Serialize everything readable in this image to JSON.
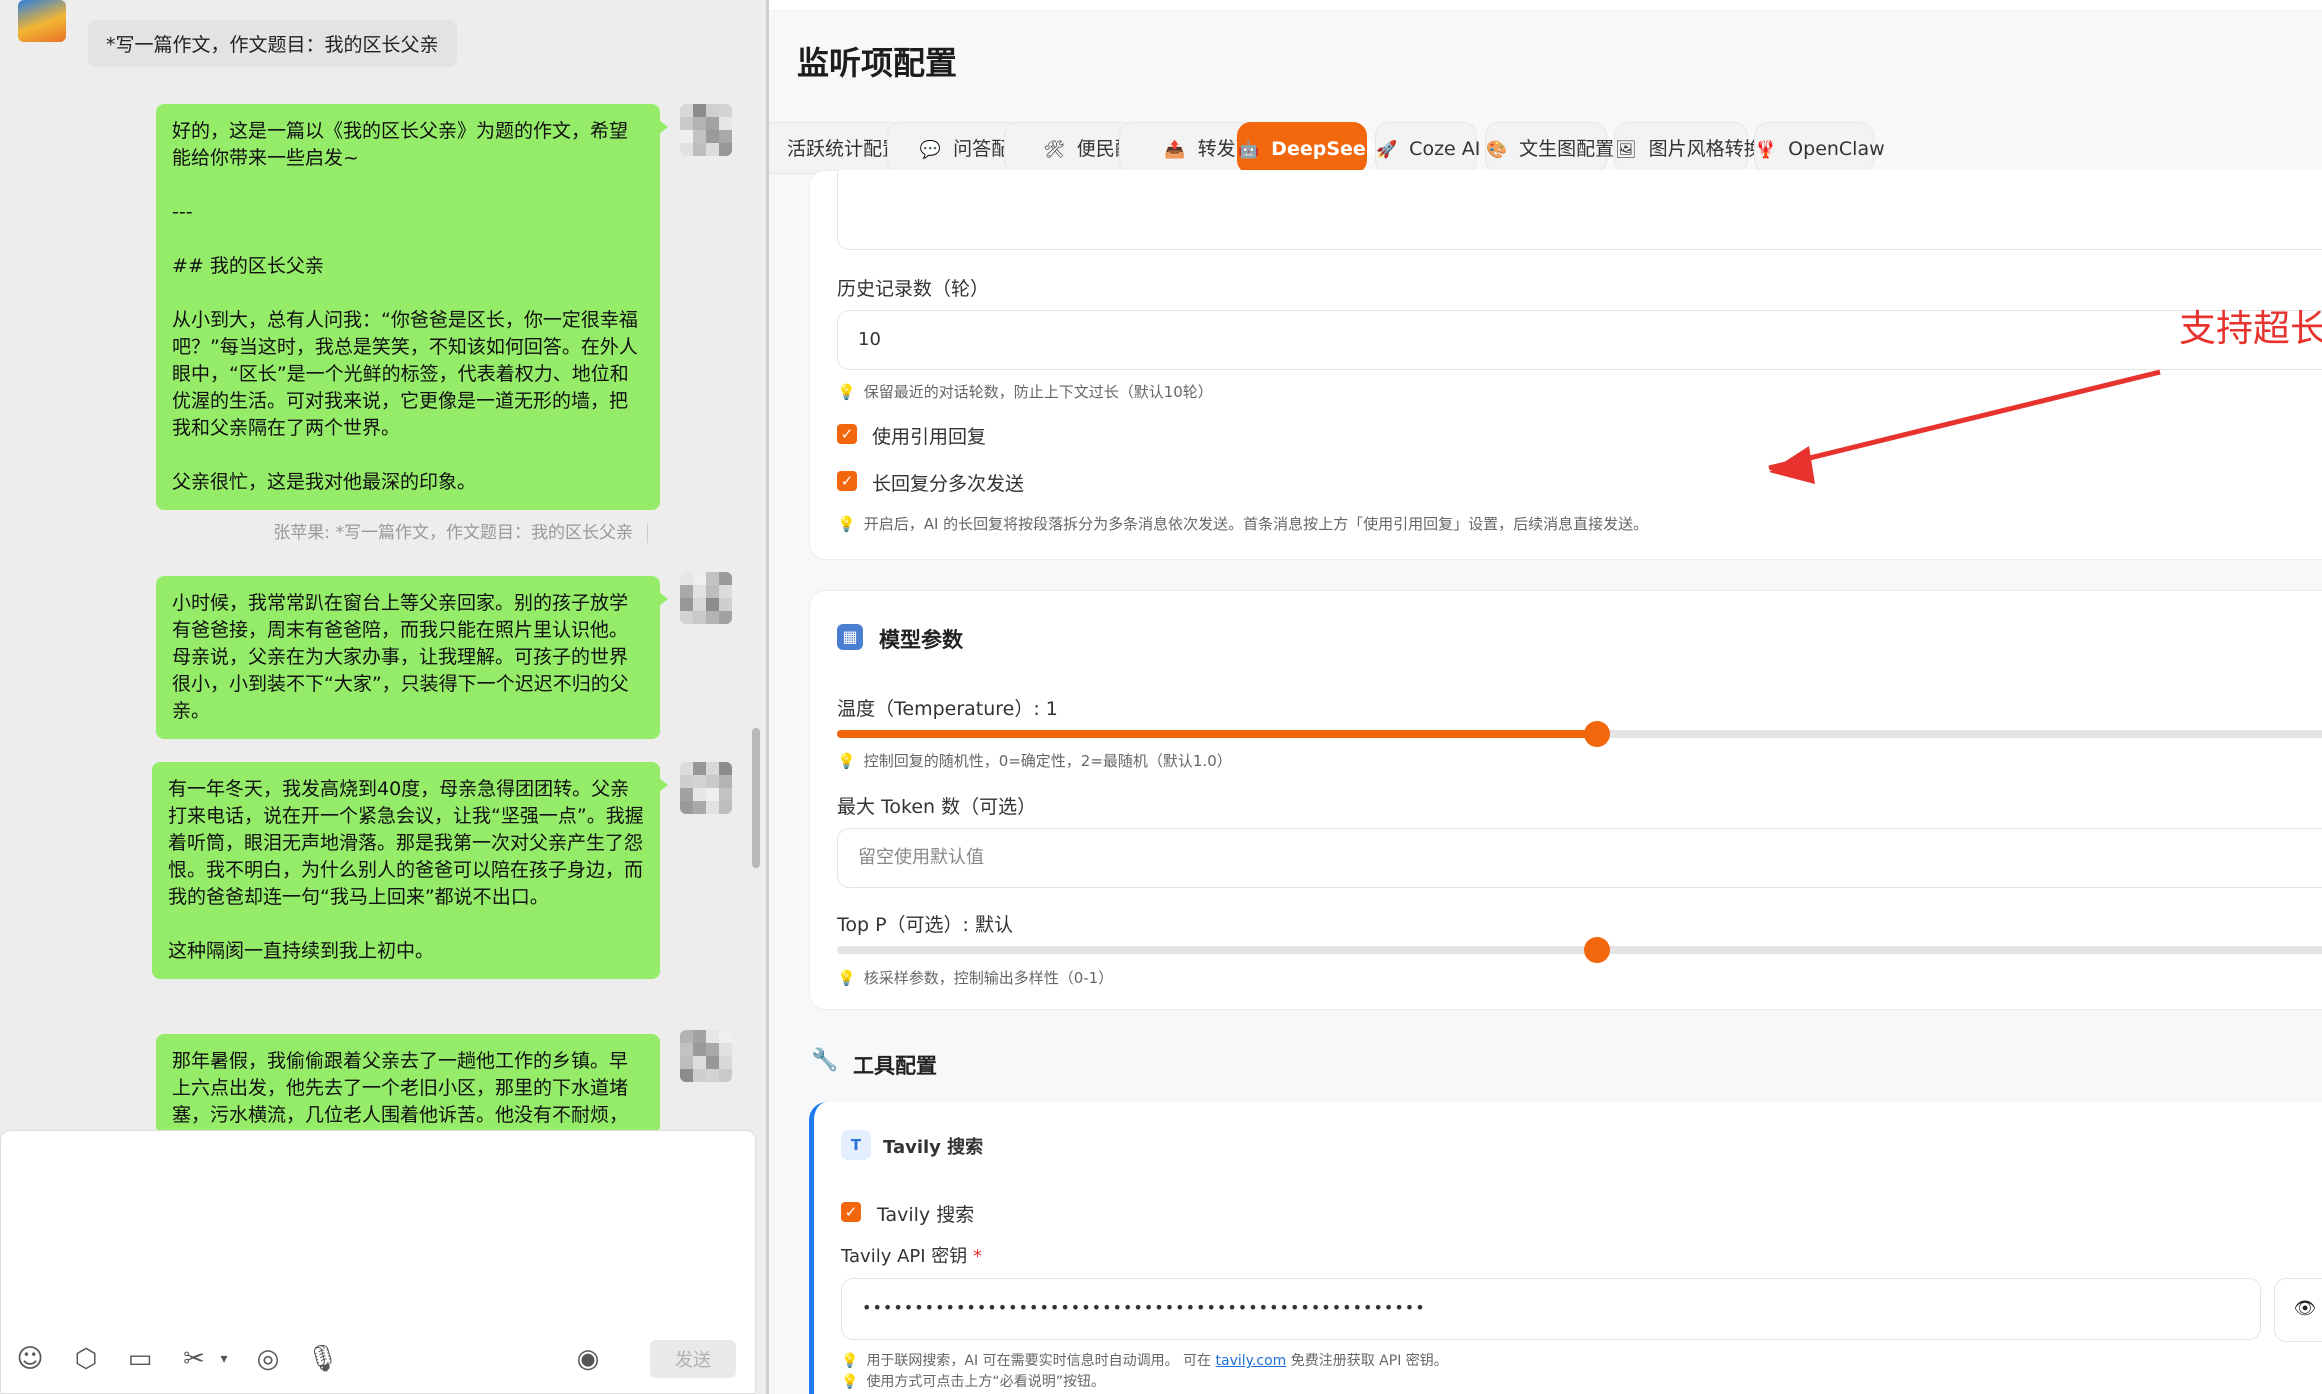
{
  "chat": {
    "incoming": "*写一篇作文，作文题目：我的区长父亲",
    "bubbles": [
      "好的，这是一篇以《我的区长父亲》为题的作文，希望能给你带来一些启发~\n\n---\n\n## 我的区长父亲\n\n从小到大，总有人问我：“你爸爸是区长，你一定很幸福吧？”每当这时，我总是笑笑，不知该如何回答。在外人眼中，“区长”是一个光鲜的标签，代表着权力、地位和优渥的生活。可对我来说，它更像是一道无形的墙，把我和父亲隔在了两个世界。\n\n父亲很忙，这是我对他最深的印象。",
      "小时候，我常常趴在窗台上等父亲回家。别的孩子放学有爸爸接，周末有爸爸陪，而我只能在照片里认识他。母亲说，父亲在为大家办事，让我理解。可孩子的世界很小，小到装不下“大家”，只装得下一个迟迟不归的父亲。",
      "有一年冬天，我发高烧到40度，母亲急得团团转。父亲打来电话，说在开一个紧急会议，让我“坚强一点”。我握着听筒，眼泪无声地滑落。那是我第一次对父亲产生了怨恨。我不明白，为什么别人的爸爸可以陪在孩子身边，而我的爸爸却连一句“我马上回来”都说不出口。\n\n这种隔阂一直持续到我上初中。",
      "那年暑假，我偷偷跟着父亲去了一趟他工作的乡镇。早上六点出发，他先去了一个老旧小区，那里的下水道堵塞，污水横流，几位老人围着他诉苦。他没有不耐烦，"
    ],
    "quote": "张苹果: *写一篇作文，作文题目：我的区长父亲",
    "send_label": "发送",
    "toolbar_icons": [
      "emoji-icon",
      "cube-icon",
      "folder-icon",
      "scissors-icon",
      "record-icon",
      "mic-icon",
      "voice-icon"
    ]
  },
  "panel": {
    "title": "监听项配置",
    "tabs": [
      {
        "icon": "",
        "label": "活跃统计配置"
      },
      {
        "icon": "💬",
        "label": "问答配置"
      },
      {
        "icon": "🛠",
        "label": "便民配置"
      },
      {
        "icon": "📤",
        "label": "转发配置"
      },
      {
        "icon": "🤖",
        "label": "DeepSeek AI"
      },
      {
        "icon": "🚀",
        "label": "Coze AI"
      },
      {
        "icon": "🎨",
        "label": "文生图配置"
      },
      {
        "icon": "🖼",
        "label": "图片风格转换"
      },
      {
        "icon": "🦞",
        "label": "OpenClaw"
      }
    ],
    "active_tab": "DeepSeek AI",
    "history_label": "历史记录数（轮）",
    "history_value": "10",
    "history_hint": "保留最近的对话轮数，防止上下文过长（默认10轮）",
    "use_quote_label": "使用引用回复",
    "use_quote_checked": true,
    "split_label": "长回复分多次发送",
    "split_checked": true,
    "split_hint": "开启后，AI 的长回复将按段落拆分为多条消息依次发送。首条消息按上方「使用引用回复」设置，后续消息直接发送。",
    "annotation": "支持超长文本，分段发送。",
    "model_section": "模型参数",
    "temperature_label": "温度（Temperature）: 1",
    "temperature_value": 1,
    "temperature_max": 2,
    "temperature_hint": "控制回复的随机性，0=确定性，2=最随机（默认1.0）",
    "max_token_label": "最大 Token 数（可选）",
    "max_token_placeholder": "留空使用默认值",
    "top_p_label": "Top P（可选）: 默认",
    "top_p_value": 0.5,
    "top_p_hint": "核采样参数，控制输出多样性（0-1）",
    "tools_section": "工具配置",
    "tavily_title": "Tavily 搜索",
    "tavily_badge": "T",
    "tavily_enable_label": "Tavily 搜索",
    "tavily_checked": true,
    "tavily_key_label": "Tavily API 密钥",
    "required_mark": "*",
    "tavily_key_value": "••••••••••••••••••••••••••••••••••••••••••••••••••••••",
    "tavily_hint1_pre": "用于联网搜索，AI 可在需要实时信息时自动调用。 可在",
    "tavily_hint1_link": "tavily.com",
    "tavily_hint1_post": "免费注册获取 API 密钥。",
    "tavily_hint2": "使用方式可点击上方“必看说明”按钮。",
    "colors": {
      "accent": "#f2660c",
      "chat_bubble": "#95ec69",
      "annotation": "#e8322e",
      "tool_border": "#1e7cf0"
    }
  }
}
